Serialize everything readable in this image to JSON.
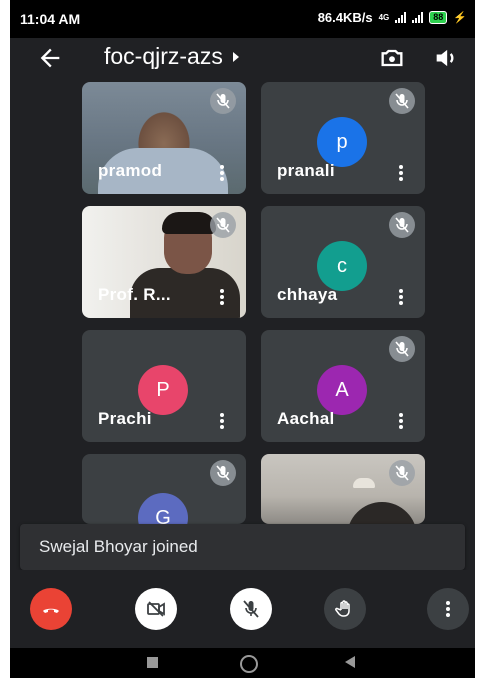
{
  "status_bar": {
    "time": "11:04 AM",
    "network_speed": "86.4KB/s",
    "network_type": "4G",
    "battery": "88",
    "battery_color": "#2ed14f"
  },
  "header": {
    "meeting_code": "foc-qjrz-azs",
    "back_icon": "back-arrow-icon",
    "switch_camera_icon": "switch-camera-icon",
    "speaker_icon": "speaker-icon"
  },
  "participants": [
    {
      "name": "pramod",
      "initial": "",
      "muted": true,
      "video": true
    },
    {
      "name": "pranali",
      "initial": "p",
      "color": "#1a73e8",
      "muted": true,
      "video": false
    },
    {
      "name": "Prof. R...",
      "initial": "",
      "muted": true,
      "video": true
    },
    {
      "name": "chhaya",
      "initial": "c",
      "color": "#129e8f",
      "muted": true,
      "video": false
    },
    {
      "name": "Prachi",
      "initial": "P",
      "color": "#e8456b",
      "muted": false,
      "video": false
    },
    {
      "name": "Aachal",
      "initial": "A",
      "color": "#9c27b0",
      "muted": true,
      "video": false
    },
    {
      "name": "",
      "initial": "G",
      "color": "#5c6bc0",
      "muted": true,
      "video": false
    },
    {
      "name": "",
      "initial": "",
      "muted": true,
      "video": true
    }
  ],
  "toast": {
    "message": "Swejal Bhoyar joined"
  },
  "controls": {
    "end_call_color": "#ea4335",
    "buttons": [
      "end-call",
      "camera-off",
      "mic-off",
      "raise-hand",
      "more-options"
    ]
  }
}
